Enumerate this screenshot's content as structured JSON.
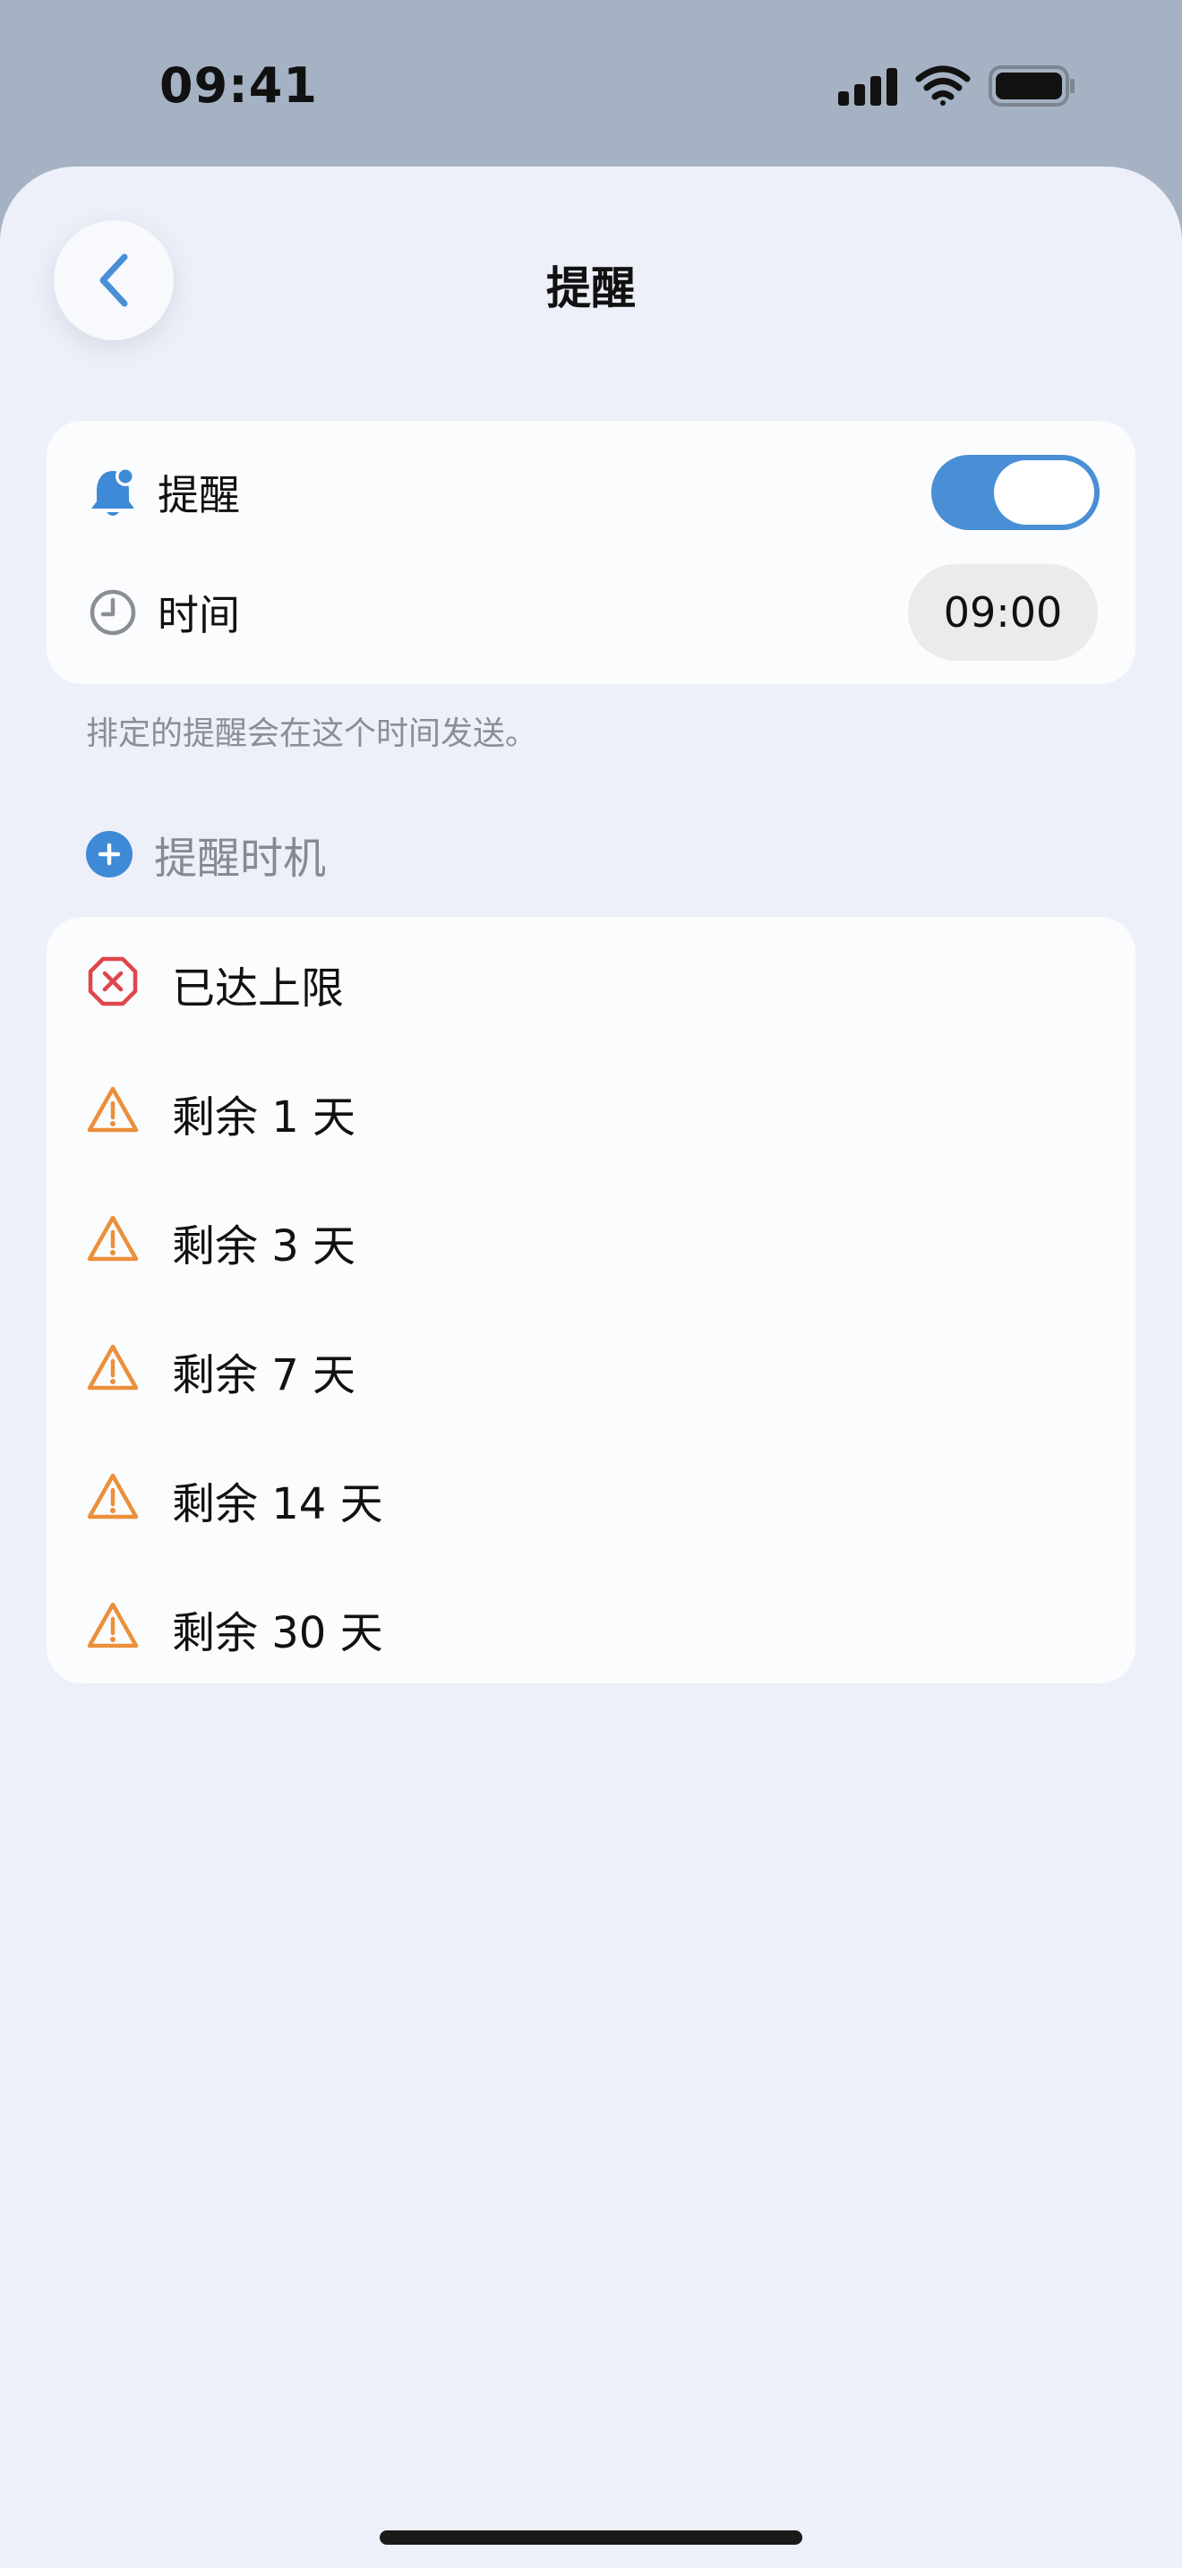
{
  "status_bar": {
    "time": "09:41"
  },
  "nav": {
    "title": "提醒"
  },
  "settings": {
    "reminder_label": "提醒",
    "reminder_enabled": true,
    "time_label": "时间",
    "time_value": "09:00",
    "footnote": "排定的提醒会在这个时间发送。"
  },
  "timing_section": {
    "title": "提醒时机",
    "items": [
      {
        "label": "已达上限",
        "icon": "x-octagon-icon",
        "color": "#e0454a"
      },
      {
        "label": "剩余 1 天",
        "icon": "warning-triangle-icon",
        "color": "#ec8f3a"
      },
      {
        "label": "剩余 3 天",
        "icon": "warning-triangle-icon",
        "color": "#ec8f3a"
      },
      {
        "label": "剩余 7 天",
        "icon": "warning-triangle-icon",
        "color": "#ec8f3a"
      },
      {
        "label": "剩余 14 天",
        "icon": "warning-triangle-icon",
        "color": "#ec8f3a"
      },
      {
        "label": "剩余 30 天",
        "icon": "warning-triangle-icon",
        "color": "#ec8f3a"
      }
    ]
  },
  "colors": {
    "accent": "#4a8fd6",
    "background": "#edf0f8",
    "card": "#fbfcfe",
    "error": "#e0454a",
    "warning": "#ec8f3a"
  }
}
